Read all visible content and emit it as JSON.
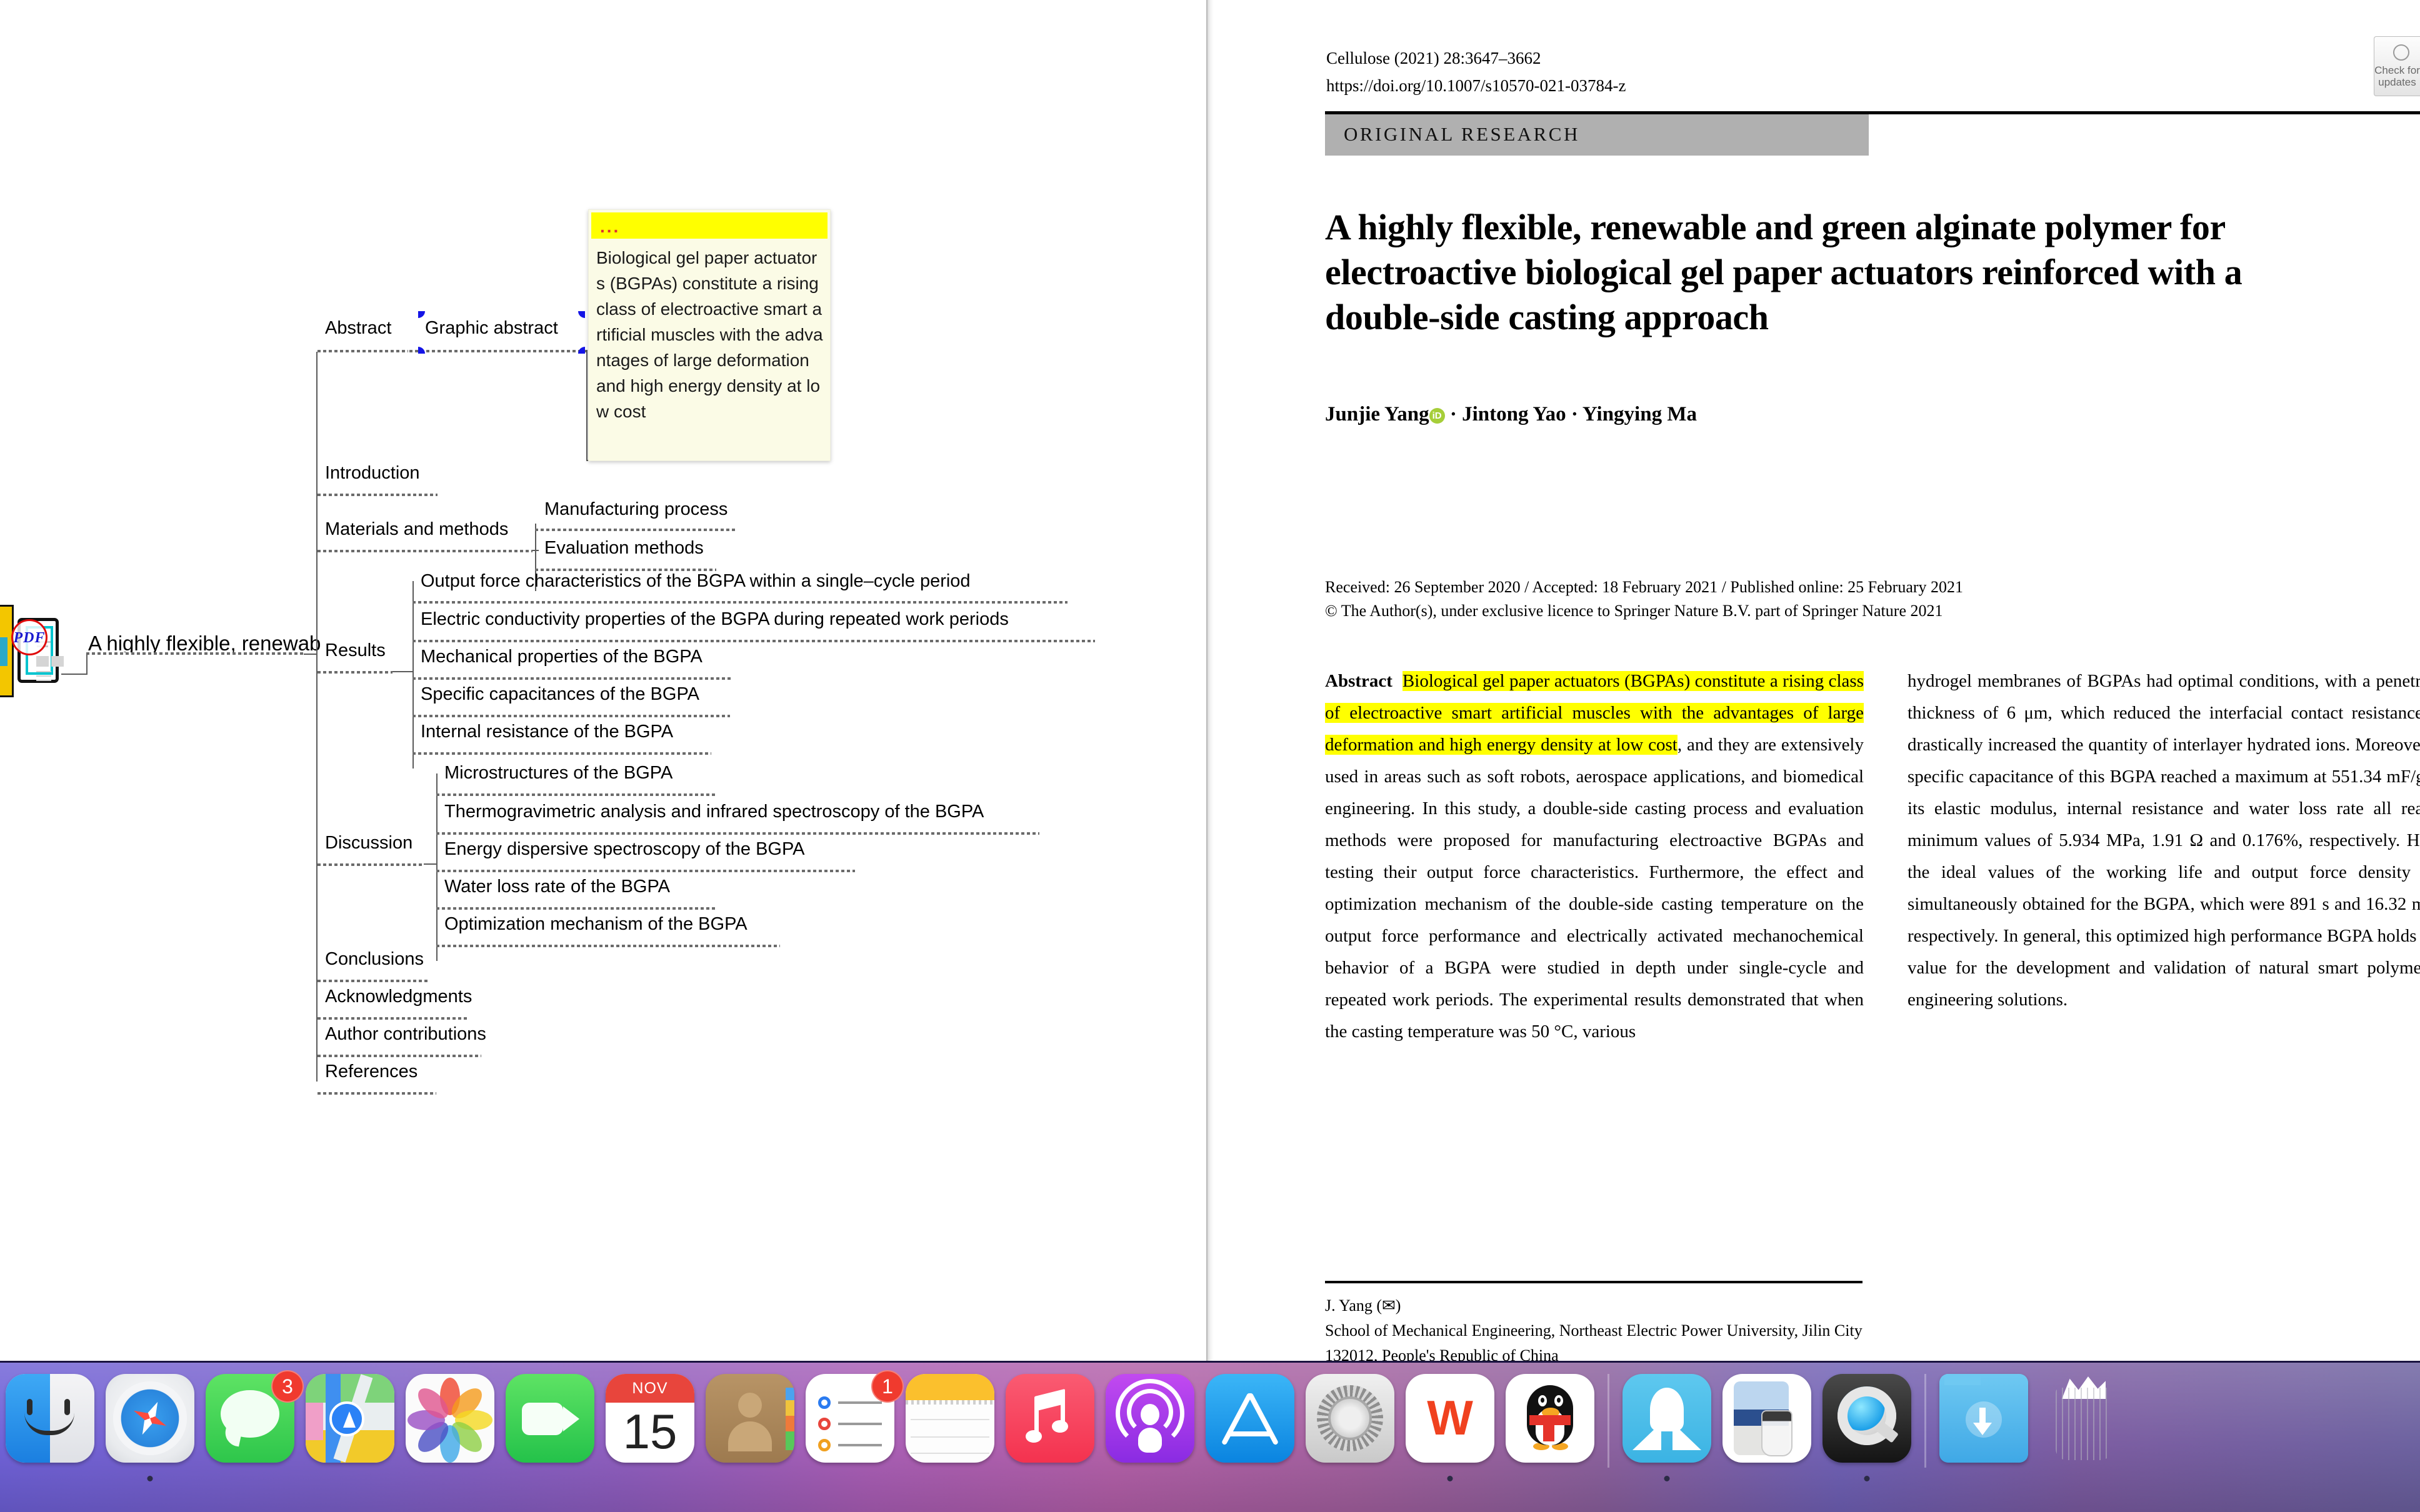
{
  "mindmap": {
    "root_label": "A highly flexible, renewab",
    "pdf_stamp": "PDF",
    "nodes": {
      "abstract": "Abstract",
      "graphic_abstract": "Graphic abstract",
      "introduction": "Introduction",
      "materials_and_methods": "Materials and methods",
      "manufacturing_process": "Manufacturing process",
      "evaluation_methods": "Evaluation methods",
      "results": "Results",
      "output_force": "Output force characteristics of the BGPA within a single–cycle period",
      "electric_conductivity": "Electric conductivity properties of the BGPA during repeated work periods",
      "mechanical_properties": "Mechanical properties of the BGPA",
      "specific_capacitances": "Specific capacitances of the BGPA",
      "internal_resistance": "Internal resistance of the BGPA",
      "discussion": "Discussion",
      "microstructures": "Microstructures of the BGPA",
      "thermogravimetric": "Thermogravimetric analysis and infrared spectroscopy of the BGPA",
      "energy_dispersive": "Energy dispersive spectroscopy of the BGPA",
      "water_loss": "Water loss rate of the BGPA",
      "optimization_mechanism": "Optimization mechanism of the BGPA",
      "conclusions": "Conclusions",
      "acknowledgments": "Acknowledgments",
      "author_contributions": "Author contributions",
      "references": "References"
    },
    "sticky_note": {
      "header_glyph": "...",
      "body": "Biological gel paper actuators (BGPAs) constitute a rising class of electroactive smart artificial muscles with the advantages of large deformation and high energy density at low cost",
      "header_color": "#ffff00",
      "body_color": "#fbfbe6"
    },
    "selection_color": "#1414e6"
  },
  "pdf": {
    "journal_line1": "Cellulose (2021) 28:3647–3662",
    "journal_line2": "https://doi.org/10.1007/s10570-021-03784-z",
    "section_banner": "ORIGINAL RESEARCH",
    "title": "A highly flexible, renewable and green alginate polymer for electroactive biological gel paper actuators reinforced with a double-side casting approach",
    "authors_before_orcid": "Junjie Yang",
    "orcid_glyph": "iD",
    "authors_after_orcid": " · Jintong Yao · Yingying Ma",
    "dates": "Received: 26 September 2020 / Accepted: 18 February 2021 / Published online: 25 February 2021",
    "copyright": "© The Author(s), under exclusive licence to Springer Nature B.V. part of Springer Nature 2021",
    "abstract_label": "Abstract",
    "abstract_highlight": "Biological gel paper actuators (BGPAs) constitute a rising class of electroactive smart artificial muscles with the advantages of large deformation and high energy density at low cost",
    "abstract_rest_left": ", and they are extensively used in areas such as soft robots, aerospace applications, and biomedical engineering. In this study, a double-side casting process and evaluation methods were proposed for manufacturing electroactive BGPAs and testing their output force characteristics. Furthermore, the effect and optimization mechanism of the double-side casting temperature on the output force performance and electrically activated mechanochemical behavior of a BGPA were studied in depth under single-cycle and repeated work periods. The experimental results demonstrated that when the casting temperature was 50 °C, various",
    "abstract_right": "hydrogel membranes of BGPAs had optimal conditions, with a penetration thickness of 6 μm, which reduced the interfacial contact resistance and drastically increased the quantity of interlayer hydrated ions. Moreover, the specific capacitance of this BGPA reached a maximum at 551.34 mF/g, but its elastic modulus, internal resistance and water loss rate all reached minimum values of 5.934 MPa, 1.91 Ω and 0.176%, respectively. Hence, the ideal values of the working life and output force density were simultaneously obtained for the BGPA, which were 891 s and 16.32 mN/g, respectively. In general, this optimized high performance BGPA holds great value for the development and validation of natural smart polymers in engineering solutions.",
    "footnote": "J. Yang (✉)\nSchool of Mechanical Engineering, Northeast Electric Power University, Jilin City 132012, People's Republic of China",
    "check_updates_label": "Check for updates",
    "highlight_color": "#ffff00",
    "banner_color": "#b0b0b0"
  },
  "dock": {
    "items": [
      {
        "name": "finder",
        "label": "Finder",
        "running": false,
        "badge": null
      },
      {
        "name": "safari",
        "label": "Safari",
        "running": true,
        "badge": null
      },
      {
        "name": "messages",
        "label": "Messages",
        "running": false,
        "badge": "3"
      },
      {
        "name": "maps",
        "label": "Maps",
        "running": false,
        "badge": null
      },
      {
        "name": "photos",
        "label": "Photos",
        "running": false,
        "badge": null
      },
      {
        "name": "facetime",
        "label": "FaceTime",
        "running": false,
        "badge": null
      },
      {
        "name": "calendar",
        "label": "Calendar",
        "running": false,
        "badge": null,
        "month": "NOV",
        "day": "15"
      },
      {
        "name": "contacts",
        "label": "Contacts",
        "running": false,
        "badge": null
      },
      {
        "name": "reminders",
        "label": "Reminders",
        "running": false,
        "badge": "1"
      },
      {
        "name": "notes",
        "label": "Notes",
        "running": false,
        "badge": null
      },
      {
        "name": "music",
        "label": "Music",
        "running": false,
        "badge": null
      },
      {
        "name": "podcasts",
        "label": "Podcasts",
        "running": false,
        "badge": null
      },
      {
        "name": "app-store",
        "label": "App Store",
        "running": false,
        "badge": null
      },
      {
        "name": "system-preferences",
        "label": "System Preferences",
        "running": false,
        "badge": null
      },
      {
        "name": "wps-office",
        "label": "WPS Office",
        "running": true,
        "badge": null
      },
      {
        "name": "qq",
        "label": "QQ",
        "running": false,
        "badge": null
      },
      {
        "name": "separator-1",
        "label": "",
        "running": false,
        "badge": null
      },
      {
        "name": "xmind",
        "label": "XMind",
        "running": true,
        "badge": null
      },
      {
        "name": "preview",
        "label": "Preview",
        "running": false,
        "badge": null
      },
      {
        "name": "quicktime-player",
        "label": "QuickTime Player",
        "running": true,
        "badge": null
      },
      {
        "name": "separator-2",
        "label": "",
        "running": false,
        "badge": null
      },
      {
        "name": "downloads",
        "label": "Downloads",
        "running": false,
        "badge": null
      },
      {
        "name": "trash",
        "label": "Trash",
        "running": false,
        "badge": null
      }
    ]
  }
}
